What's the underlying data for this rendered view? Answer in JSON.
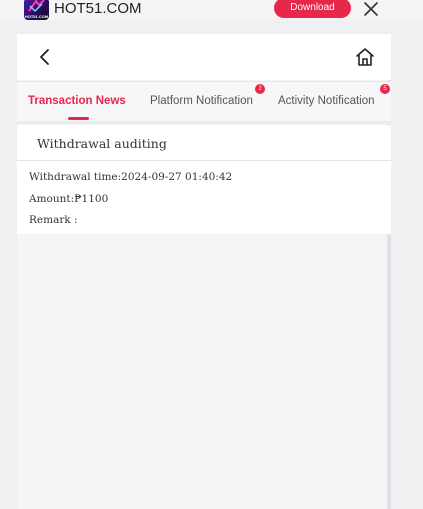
{
  "topbar": {
    "logo_text": "HOT51.COM",
    "brand": "HOT51.COM",
    "download_label": "Download"
  },
  "tabs": [
    {
      "label": "Transaction News",
      "active": true,
      "badge": ""
    },
    {
      "label": "Platform Notification",
      "active": false,
      "badge": "2"
    },
    {
      "label": "Activity Notification",
      "active": false,
      "badge": "5"
    }
  ],
  "card": {
    "title": "Withdrawal auditing",
    "time": "Withdrawal time:2024-09-27 01:40:42",
    "amount": "Amount:₱1100",
    "remark": "Remark :"
  },
  "colors": {
    "accent": "#e8284a",
    "background": "#f0f0f2"
  },
  "icons": [
    "logo-icon",
    "close-icon",
    "back-icon",
    "home-icon"
  ]
}
